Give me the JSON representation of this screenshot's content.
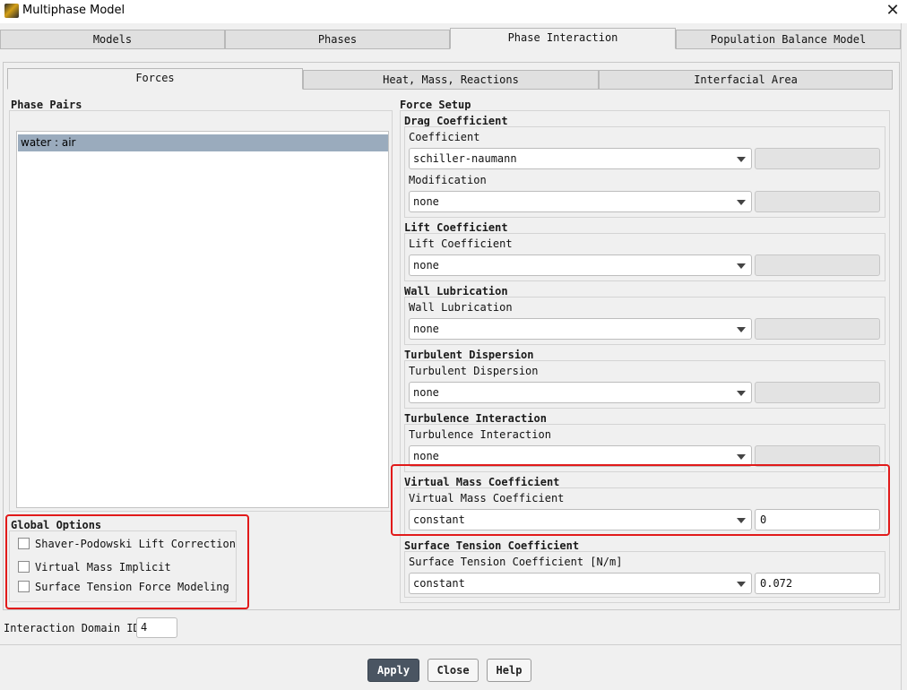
{
  "window": {
    "title": "Multiphase Model",
    "close_label": "✕"
  },
  "top_tabs": [
    "Models",
    "Phases",
    "Phase Interaction",
    "Population Balance Model"
  ],
  "sub_tabs": [
    "Forces",
    "Heat, Mass, Reactions",
    "Interfacial Area"
  ],
  "phase_pairs": {
    "title": "Phase Pairs",
    "items": [
      "water : air"
    ]
  },
  "force_setup": {
    "title": "Force Setup",
    "drag": {
      "title": "Drag Coefficient",
      "coefficient_label": "Coefficient",
      "coefficient_value": "schiller-naumann",
      "modification_label": "Modification",
      "modification_value": "none"
    },
    "lift": {
      "title": "Lift Coefficient",
      "label": "Lift Coefficient",
      "value": "none"
    },
    "wall": {
      "title": "Wall Lubrication",
      "label": "Wall Lubrication",
      "value": "none"
    },
    "turb_disp": {
      "title": "Turbulent Dispersion",
      "label": "Turbulent Dispersion",
      "value": "none"
    },
    "turb_inter": {
      "title": "Turbulence Interaction",
      "label": "Turbulence Interaction",
      "value": "none"
    },
    "virtual_mass": {
      "title": "Virtual Mass Coefficient",
      "label": "Virtual Mass Coefficient",
      "value": "constant",
      "number": "0"
    },
    "surface_tension": {
      "title": "Surface Tension Coefficient",
      "label": "Surface Tension Coefficient [N/m]",
      "value": "constant",
      "number": "0.072"
    }
  },
  "global_options": {
    "title": "Global Options",
    "options": [
      "Shaver-Podowski Lift Correction",
      "Virtual Mass Implicit",
      "Surface Tension Force Modeling"
    ]
  },
  "interaction_domain": {
    "label": "Interaction Domain ID",
    "value": "4"
  },
  "buttons": {
    "apply": "Apply",
    "close": "Close",
    "help": "Help"
  },
  "colors": {
    "selection": "#9aabbd",
    "highlight": "#e11a1a",
    "primary_button": "#4a5562"
  }
}
